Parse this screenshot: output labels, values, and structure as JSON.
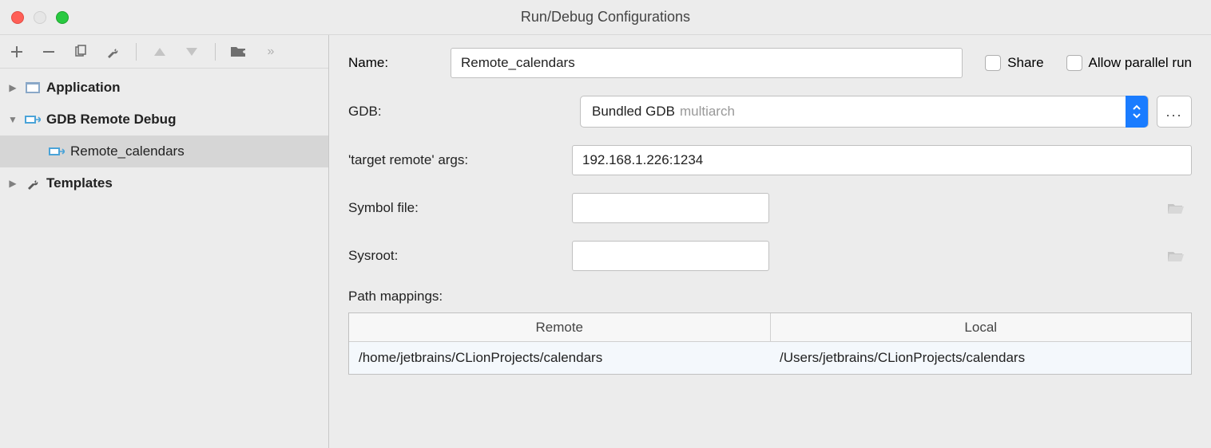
{
  "window": {
    "title": "Run/Debug Configurations"
  },
  "tree": {
    "application": "Application",
    "gdb_remote": "GDB Remote Debug",
    "selected": "Remote_calendars",
    "templates": "Templates"
  },
  "form": {
    "name_label": "Name:",
    "name_value": "Remote_calendars",
    "share_label": "Share",
    "allow_parallel_label": "Allow parallel run",
    "gdb_label": "GDB:",
    "gdb_value": "Bundled GDB",
    "gdb_suffix": "multiarch",
    "target_remote_label": "'target remote' args:",
    "target_remote_value": "192.168.1.226:1234",
    "symbol_file_label": "Symbol file:",
    "symbol_file_value": "",
    "sysroot_label": "Sysroot:",
    "sysroot_value": "",
    "path_mappings_label": "Path mappings:",
    "mapping_header_remote": "Remote",
    "mapping_header_local": "Local",
    "mappings": [
      {
        "remote": "/home/jetbrains/CLionProjects/calendars",
        "local": "/Users/jetbrains/CLionProjects/calendars"
      }
    ],
    "dots": "..."
  }
}
